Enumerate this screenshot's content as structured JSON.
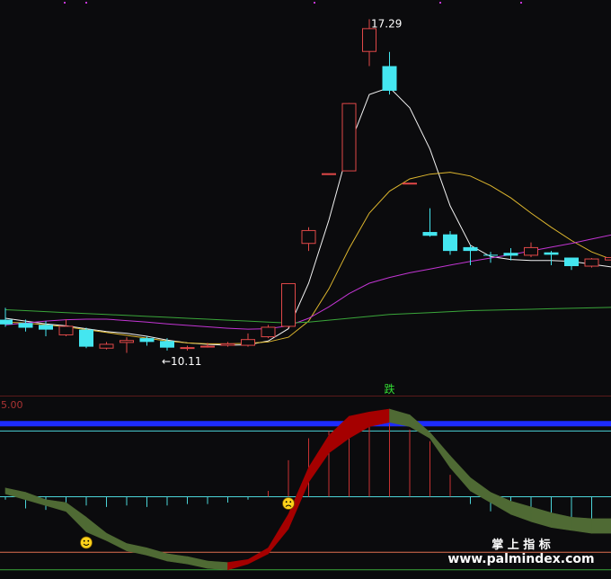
{
  "chart_data": [
    {
      "type": "candlestick",
      "panel": "price",
      "title": "",
      "xlabel": "",
      "ylabel": "",
      "ylim": [
        9.5,
        17.6
      ],
      "colors": {
        "up": "#e04848",
        "down": "#44e6f0"
      },
      "candles": [
        {
          "o": 10.95,
          "h": 11.2,
          "l": 10.8,
          "c": 10.85
        },
        {
          "o": 10.88,
          "h": 10.95,
          "l": 10.7,
          "c": 10.78
        },
        {
          "o": 10.84,
          "h": 10.92,
          "l": 10.6,
          "c": 10.74
        },
        {
          "o": 10.62,
          "h": 10.96,
          "l": 10.6,
          "c": 10.82
        },
        {
          "o": 10.74,
          "h": 10.78,
          "l": 10.35,
          "c": 10.38
        },
        {
          "o": 10.34,
          "h": 10.48,
          "l": 10.32,
          "c": 10.44
        },
        {
          "o": 10.46,
          "h": 10.58,
          "l": 10.25,
          "c": 10.52
        },
        {
          "o": 10.56,
          "h": 10.6,
          "l": 10.4,
          "c": 10.48
        },
        {
          "o": 10.5,
          "h": 10.56,
          "l": 10.3,
          "c": 10.36
        },
        {
          "o": 10.36,
          "h": 10.4,
          "l": 10.3,
          "c": 10.37
        },
        {
          "o": 10.38,
          "h": 10.46,
          "l": 10.36,
          "c": 10.4
        },
        {
          "o": 10.4,
          "h": 10.48,
          "l": 10.38,
          "c": 10.45
        },
        {
          "o": 10.4,
          "h": 10.66,
          "l": 10.38,
          "c": 10.54
        },
        {
          "o": 10.58,
          "h": 10.84,
          "l": 10.56,
          "c": 10.8
        },
        {
          "o": 10.8,
          "h": 11.72,
          "l": 10.78,
          "c": 11.72
        },
        {
          "o": 12.55,
          "h": 12.9,
          "l": 12.4,
          "c": 12.84
        },
        {
          "o": 14.04,
          "h": 14.04,
          "l": 14.04,
          "c": 14.04
        },
        {
          "o": 14.08,
          "h": 15.52,
          "l": 14.08,
          "c": 15.52
        },
        {
          "o": 16.6,
          "h": 17.29,
          "l": 16.3,
          "c": 17.1
        },
        {
          "o": 16.3,
          "h": 16.6,
          "l": 15.7,
          "c": 15.78
        },
        {
          "o": 13.84,
          "h": 13.84,
          "l": 13.84,
          "c": 13.84
        },
        {
          "o": 12.8,
          "h": 13.3,
          "l": 12.7,
          "c": 12.72
        },
        {
          "o": 12.75,
          "h": 12.82,
          "l": 12.32,
          "c": 12.4
        },
        {
          "o": 12.48,
          "h": 12.52,
          "l": 12.1,
          "c": 12.4
        },
        {
          "o": 12.32,
          "h": 12.38,
          "l": 12.15,
          "c": 12.3
        },
        {
          "o": 12.36,
          "h": 12.46,
          "l": 12.2,
          "c": 12.3
        },
        {
          "o": 12.3,
          "h": 12.58,
          "l": 12.27,
          "c": 12.48
        },
        {
          "o": 12.37,
          "h": 12.4,
          "l": 12.1,
          "c": 12.32
        },
        {
          "o": 12.26,
          "h": 12.26,
          "l": 12.0,
          "c": 12.08
        },
        {
          "o": 12.07,
          "h": 12.25,
          "l": 12.05,
          "c": 12.24
        },
        {
          "o": 12.2,
          "h": 12.68,
          "l": 12.2,
          "c": 12.27
        }
      ],
      "series": [
        {
          "color": "#f2f2f2",
          "values": [
            10.98,
            10.92,
            10.86,
            10.82,
            10.76,
            10.7,
            10.66,
            10.6,
            10.52,
            10.46,
            10.43,
            10.41,
            10.42,
            10.5,
            10.76,
            11.72,
            13.05,
            14.6,
            15.7,
            15.85,
            15.42,
            14.55,
            13.35,
            12.52,
            12.28,
            12.22,
            12.2,
            12.2,
            12.18,
            12.12,
            12.06
          ]
        },
        {
          "color": "#ddb62e",
          "values": [
            10.9,
            10.88,
            10.84,
            10.8,
            10.74,
            10.68,
            10.62,
            10.56,
            10.5,
            10.46,
            10.44,
            10.44,
            10.45,
            10.48,
            10.58,
            10.92,
            11.6,
            12.45,
            13.2,
            13.66,
            13.92,
            14.02,
            14.06,
            13.98,
            13.78,
            13.52,
            13.2,
            12.9,
            12.62,
            12.38,
            12.22
          ]
        },
        {
          "color": "#c235d3",
          "values": [
            10.84,
            10.88,
            10.92,
            10.95,
            10.96,
            10.96,
            10.93,
            10.9,
            10.86,
            10.83,
            10.8,
            10.77,
            10.75,
            10.76,
            10.82,
            10.98,
            11.22,
            11.5,
            11.72,
            11.84,
            11.94,
            12.02,
            12.1,
            12.18,
            12.25,
            12.32,
            12.4,
            12.48,
            12.56,
            12.65,
            12.74
          ]
        },
        {
          "color": "#3aa63a",
          "values": [
            11.16,
            11.14,
            11.12,
            11.1,
            11.08,
            11.06,
            11.04,
            11.02,
            11.0,
            10.98,
            10.96,
            10.94,
            10.92,
            10.9,
            10.88,
            10.9,
            10.94,
            10.98,
            11.02,
            11.06,
            11.08,
            11.1,
            11.12,
            11.14,
            11.15,
            11.16,
            11.17,
            11.18,
            11.19,
            11.2,
            11.21
          ]
        }
      ],
      "annotations": [
        {
          "text": "17.29",
          "type": "max",
          "candle": 18
        },
        {
          "text": "←10.11",
          "type": "min",
          "candle": 8
        }
      ],
      "signal_label": {
        "text": "跌",
        "candle": 19
      }
    },
    {
      "type": "area",
      "panel": "indicator",
      "ylim": [
        -2,
        102
      ],
      "tick_label": "5.00",
      "levels": [
        {
          "value": 100,
          "color": "#1d2bff",
          "width": "thick"
        },
        {
          "value": 95,
          "color": "#4bd4d8"
        },
        {
          "value": 50,
          "color": "#4bd4d8"
        },
        {
          "value": 12,
          "color": "#e07050"
        },
        {
          "value": 0,
          "color": "#3aa63a"
        }
      ],
      "band": {
        "colors": {
          "rising": "#a50000",
          "falling": "#4f6a34"
        },
        "upper": [
          56,
          53,
          48,
          46,
          36,
          25,
          18,
          15,
          11,
          9,
          6,
          5,
          7,
          15,
          38,
          70,
          92,
          105,
          108,
          110,
          106,
          94,
          78,
          63,
          53,
          47,
          43,
          39,
          36,
          35,
          35
        ],
        "lower": [
          52,
          48,
          44,
          40,
          26,
          20,
          13,
          10,
          6,
          4,
          1,
          0,
          4,
          11,
          28,
          60,
          80,
          90,
          98,
          101,
          98,
          90,
          70,
          54,
          46,
          38,
          33,
          29,
          27,
          25,
          25
        ]
      },
      "histogram_lines": {
        "base": 50,
        "values": [
          48,
          42,
          41,
          45,
          44,
          43,
          44,
          43,
          44,
          45,
          45,
          46,
          48,
          54,
          75,
          90,
          95,
          100,
          104,
          100,
          96,
          88,
          65,
          45,
          40,
          38,
          36,
          35,
          34,
          33,
          32
        ]
      },
      "markers": [
        {
          "icon": "frown-face-icon",
          "candle": 14
        },
        {
          "icon": "smile-face-icon",
          "candle": 4
        }
      ]
    }
  ],
  "watermark": {
    "line1": "掌 上 指 标",
    "line2": "www.palmindex.com"
  }
}
